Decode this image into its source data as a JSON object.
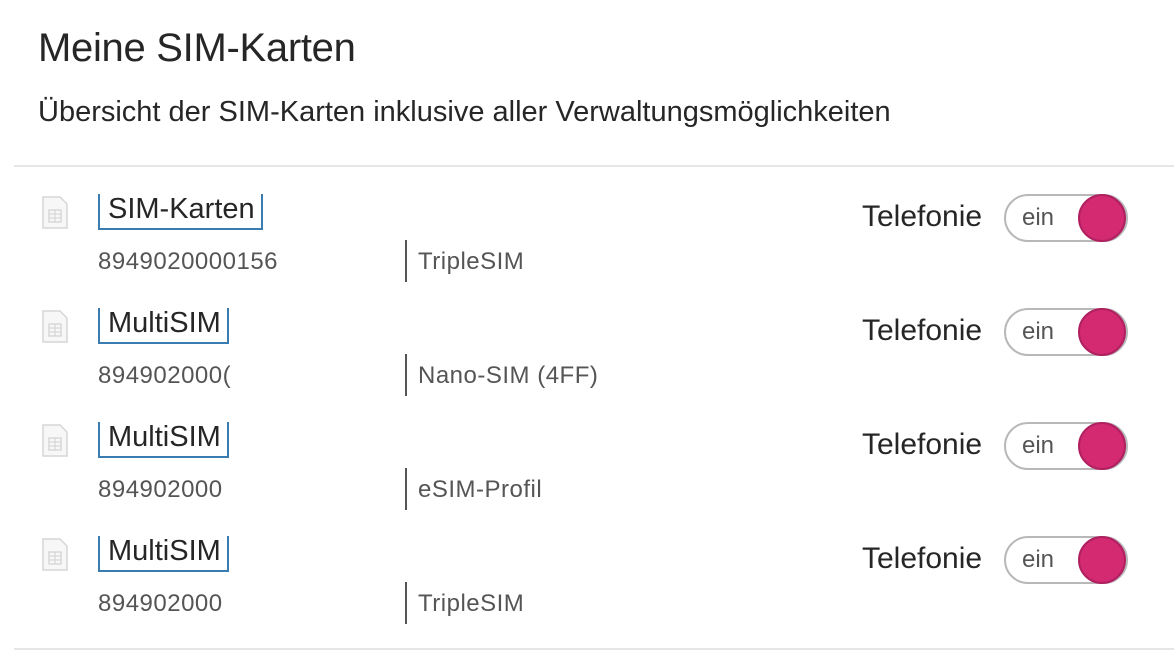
{
  "header": {
    "title": "Meine SIM-Karten",
    "subtitle": "Übersicht der SIM-Karten inklusive aller Verwaltungsmöglichkeiten"
  },
  "icons": {
    "sim": "sim-card-icon"
  },
  "colors": {
    "toggle_on": "#d32a72",
    "link_underline": "#3a7bb0"
  },
  "sims": [
    {
      "name": "SIM-Karten",
      "number": "8949020000156",
      "type": "TripleSIM",
      "service_label": "Telefonie",
      "toggle_label": "ein",
      "enabled": true
    },
    {
      "name": "MultiSIM",
      "number": "894902000(",
      "type": "Nano-SIM (4FF)",
      "service_label": "Telefonie",
      "toggle_label": "ein",
      "enabled": true
    },
    {
      "name": "MultiSIM",
      "number": "894902000",
      "type": "eSIM-Profil",
      "service_label": "Telefonie",
      "toggle_label": "ein",
      "enabled": true
    },
    {
      "name": "MultiSIM",
      "number": "894902000",
      "type": "TripleSIM",
      "service_label": "Telefonie",
      "toggle_label": "ein",
      "enabled": true
    }
  ]
}
